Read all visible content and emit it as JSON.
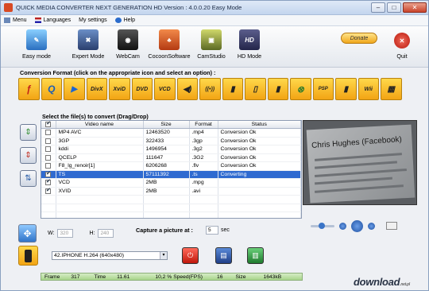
{
  "window": {
    "title": "QUICK MEDIA CONVERTER NEXT GENERATION HD Version : 4.0.0.20 Easy Mode"
  },
  "menu": [
    "Menu",
    "Languages",
    "My settings",
    "Help"
  ],
  "toolbar": {
    "buttons": [
      "Easy mode",
      "Expert Mode",
      "WebCam",
      "CocoonSoftware",
      "CamStudio",
      "HD Mode"
    ],
    "hd_icon_text": "HD",
    "donate": "Donate",
    "quit": "Quit"
  },
  "conversion_format": {
    "label": "Conversion Format (click on the appropriate icon and select an option) :",
    "icons": [
      "flash-icon",
      "quicktime-icon",
      "wmp-icon",
      "DivX",
      "XviD",
      "DVD",
      "VCD",
      "audio-icon",
      "audio-wave-icon",
      "phone-icon",
      "smartphone-icon",
      "mobile-icon",
      "xbox-icon",
      "PSP",
      "ipod-icon",
      "Wii",
      "gamecube-icon"
    ]
  },
  "files": {
    "label": "Select  the  file(s) to convert (Drag/Drop)",
    "columns": [
      "",
      "Video name",
      "Size",
      "Format",
      "Status"
    ],
    "rows": [
      {
        "checked": false,
        "name": "MP4 AVC",
        "size": "12463520",
        "format": ".mp4",
        "status": "Conversion Ok",
        "selected": false
      },
      {
        "checked": false,
        "name": "3GP",
        "size": "322433",
        "format": ".3gp",
        "status": "Conversion Ok",
        "selected": false
      },
      {
        "checked": false,
        "name": "kddi",
        "size": "1496954",
        "format": ".3g2",
        "status": "Conversion Ok",
        "selected": false
      },
      {
        "checked": false,
        "name": "QCELP",
        "size": "111647",
        "format": ".3G2",
        "status": "Conversion Ok",
        "selected": false
      },
      {
        "checked": false,
        "name": "F8_lg_renoir[1]",
        "size": "6206268",
        "format": ".flv",
        "status": "Conversion Ok",
        "selected": false
      },
      {
        "checked": true,
        "name": "TS",
        "size": "57111392",
        "format": ".ts",
        "status": "Converting",
        "selected": true
      },
      {
        "checked": true,
        "name": "VCD",
        "size": "2MB",
        "format": ".mpg",
        "status": "",
        "selected": false
      },
      {
        "checked": true,
        "name": "XVID",
        "size": "2MB",
        "format": ".avi",
        "status": "",
        "selected": false
      }
    ]
  },
  "preview": {
    "headline": "Chris Hughes (Facebook)"
  },
  "size": {
    "w_label": "W:",
    "w_value": "320",
    "h_label": "H:",
    "h_value": "240"
  },
  "capture": {
    "label": "Capture a picture at :",
    "value": "5",
    "unit": "sec"
  },
  "profile": {
    "value": "42.IPHONE H.264 (640x480)"
  },
  "status": {
    "frame_label": "Frame",
    "frame_value": "317",
    "time_label": "Time",
    "time_value": "11.61",
    "percent": "10,2 %",
    "speed_label": "Speed(FPS)",
    "speed_value": "16",
    "size_label": "Size",
    "size_value": "1643kB"
  },
  "watermark": {
    "main": "download",
    "sub": ".net.pl"
  }
}
